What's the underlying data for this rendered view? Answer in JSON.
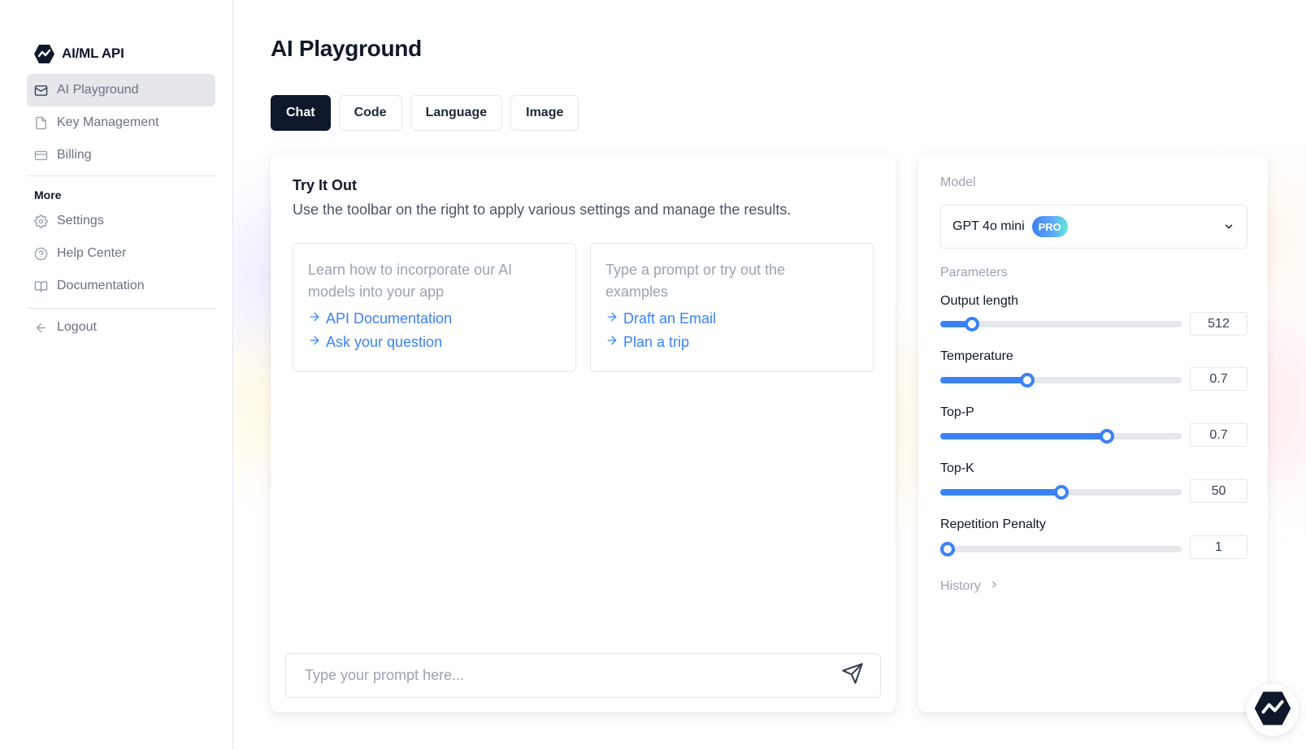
{
  "brand": {
    "name": "AI/ML API",
    "logo_icon": "aimlapi-logo-icon"
  },
  "sidebar": {
    "items": [
      {
        "label": "AI Playground",
        "icon": "mail-icon",
        "active": true
      },
      {
        "label": "Key Management",
        "icon": "file-icon"
      },
      {
        "label": "Billing",
        "icon": "credit-card-icon"
      }
    ],
    "more_heading": "More",
    "more_items": [
      {
        "label": "Settings",
        "icon": "gear-icon"
      },
      {
        "label": "Help Center",
        "icon": "help-circle-icon"
      },
      {
        "label": "Documentation",
        "icon": "book-icon"
      }
    ],
    "logout": {
      "label": "Logout",
      "icon": "arrow-left-icon"
    }
  },
  "header": {
    "title": "AI Playground",
    "tabs": [
      {
        "label": "Chat",
        "active": true
      },
      {
        "label": "Code"
      },
      {
        "label": "Language"
      },
      {
        "label": "Image"
      }
    ]
  },
  "chat": {
    "title": "Try It Out",
    "subtitle": "Use the toolbar on the right to apply various settings and manage the results.",
    "examples": [
      {
        "description": "Learn how to incorporate our AI models into your app",
        "links": [
          "API Documentation",
          "Ask your question"
        ]
      },
      {
        "description": "Type a prompt or try out the examples",
        "links": [
          "Draft an Email",
          "Plan a trip"
        ]
      }
    ],
    "prompt": {
      "placeholder": "Type your prompt here...",
      "value": ""
    },
    "send_icon": "send-icon"
  },
  "settings": {
    "model_label": "Model",
    "model": {
      "name": "GPT 4o mini",
      "badge": "PRO"
    },
    "parameters_label": "Parameters",
    "parameters": [
      {
        "label": "Output length",
        "value": "512",
        "fraction": 0.13
      },
      {
        "label": "Temperature",
        "value": "0.7",
        "fraction": 0.36
      },
      {
        "label": "Top-P",
        "value": "0.7",
        "fraction": 0.69
      },
      {
        "label": "Top-K",
        "value": "50",
        "fraction": 0.5
      },
      {
        "label": "Repetition Penalty",
        "value": "1",
        "fraction": 0.03
      }
    ],
    "history_label": "History"
  },
  "colors": {
    "accent": "#3b82f6",
    "dark": "#0f172a"
  }
}
